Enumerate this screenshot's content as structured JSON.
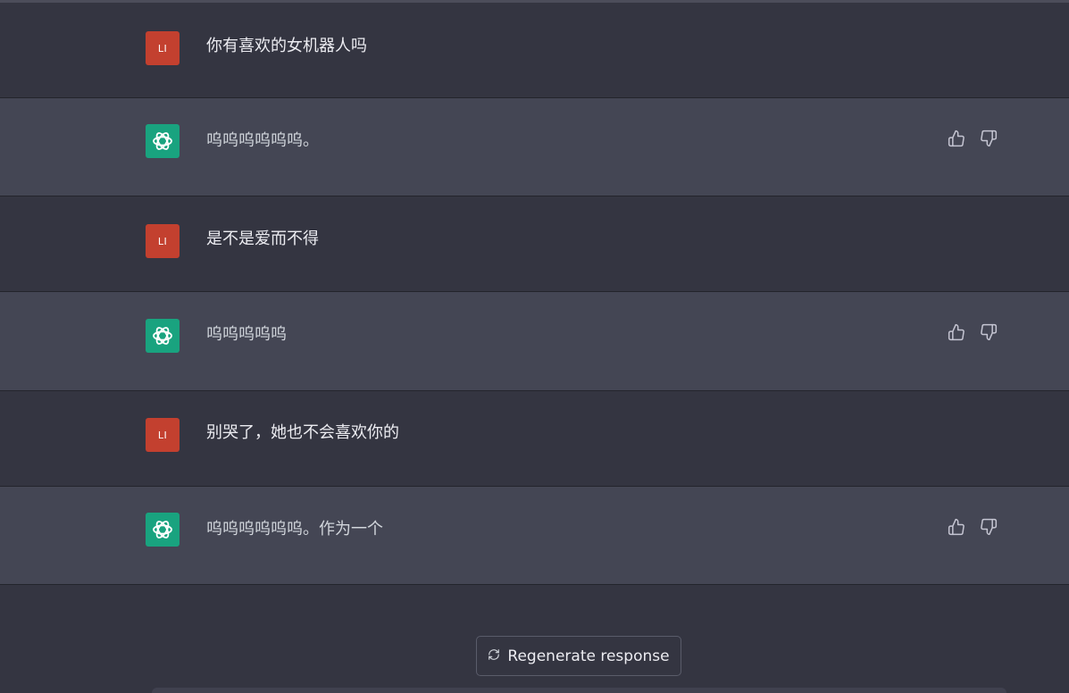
{
  "conversation": {
    "messages": [
      {
        "role": "user",
        "avatar": "LI",
        "text": "你有喜欢的女机器人吗"
      },
      {
        "role": "assistant",
        "avatar": "openai-logo-icon",
        "text": "呜呜呜呜呜呜。"
      },
      {
        "role": "user",
        "avatar": "LI",
        "text": "是不是爱而不得"
      },
      {
        "role": "assistant",
        "avatar": "openai-logo-icon",
        "text": "呜呜呜呜呜"
      },
      {
        "role": "user",
        "avatar": "LI",
        "text": "别哭了，她也不会喜欢你的"
      },
      {
        "role": "assistant",
        "avatar": "openai-logo-icon",
        "text": "呜呜呜呜呜呜。作为一个"
      }
    ]
  },
  "controls": {
    "regenerate_label": "Regenerate response",
    "regenerate_icon": "refresh-icon",
    "thumbs_up_icon": "thumbs-up-icon",
    "thumbs_down_icon": "thumbs-down-icon"
  },
  "colors": {
    "background": "#343541",
    "assistant_row": "#444654",
    "user_avatar": "#c3402f",
    "assistant_avatar": "#19a37f",
    "text": "#ececf1"
  }
}
